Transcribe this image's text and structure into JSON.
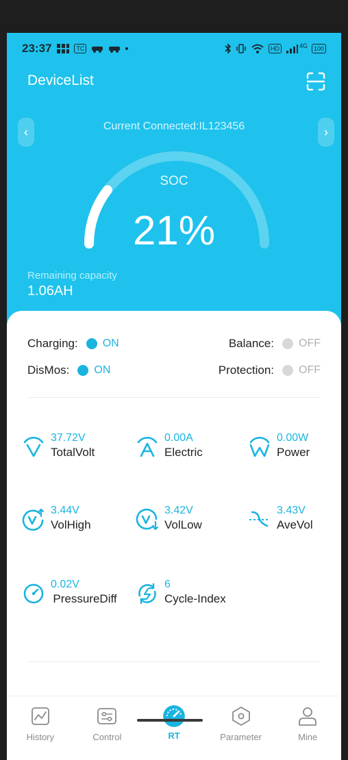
{
  "statusbar": {
    "time": "23:37",
    "badge_tc": "TC",
    "badge_hd": "HD",
    "network": "4G",
    "battery": "100"
  },
  "header": {
    "title": "DeviceList"
  },
  "connection": {
    "text": "Current Connected:IL123456"
  },
  "soc": {
    "label": "SOC",
    "value_text": "21%",
    "fraction": 0.21
  },
  "capacity": {
    "label": "Remaining capacity",
    "value": "1.06AH"
  },
  "toggles": {
    "charging": {
      "label": "Charging:",
      "state": "ON"
    },
    "balance": {
      "label": "Balance:",
      "state": "OFF"
    },
    "dismos": {
      "label": "DisMos:",
      "state": "ON"
    },
    "protection": {
      "label": "Protection:",
      "state": "OFF"
    }
  },
  "metrics": [
    {
      "value": "37.72V",
      "name": "TotalVolt",
      "icon": "total-volt-icon"
    },
    {
      "value": "0.00A",
      "name": "Electric",
      "icon": "current-icon"
    },
    {
      "value": "0.00W",
      "name": "Power",
      "icon": "power-icon"
    },
    {
      "value": "3.44V",
      "name": "VolHigh",
      "icon": "voltage-high-icon"
    },
    {
      "value": "3.42V",
      "name": "VolLow",
      "icon": "voltage-low-icon"
    },
    {
      "value": "3.43V",
      "name": "AveVol",
      "icon": "average-voltage-icon"
    },
    {
      "value": "0.02V",
      "name": "PressureDiff",
      "icon": "pressure-diff-icon"
    },
    {
      "value": "6",
      "name": "Cycle-Index",
      "icon": "cycle-icon"
    }
  ],
  "tabs": [
    {
      "label": "History",
      "icon": "history-chart-icon"
    },
    {
      "label": "Control",
      "icon": "control-sliders-icon"
    },
    {
      "label": "RT",
      "icon": "realtime-gauge-icon"
    },
    {
      "label": "Parameter",
      "icon": "parameter-hexagon-icon"
    },
    {
      "label": "Mine",
      "icon": "user-profile-icon"
    }
  ],
  "colors": {
    "accent": "#1ab4e0",
    "hero_bg": "#1ec2ec",
    "off": "#d8d8d8"
  }
}
